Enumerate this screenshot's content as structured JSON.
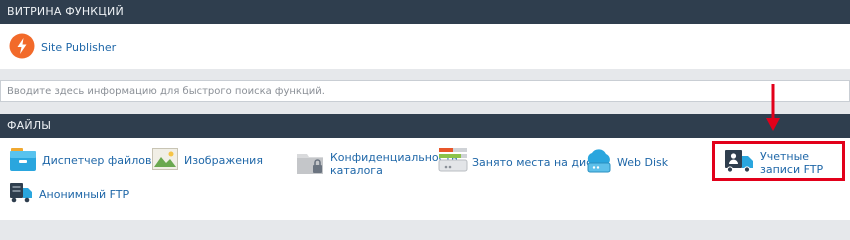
{
  "featured": {
    "title": "ВИТРИНА ФУНКЦИЙ",
    "items": [
      {
        "label": "Site Publisher",
        "icon": "lightning-bolt-icon"
      }
    ]
  },
  "search": {
    "placeholder": "Вводите здесь информацию для быстрого поиска функций."
  },
  "files": {
    "title": "ФАЙЛЫ",
    "items": [
      {
        "label": "Диспетчер файлов",
        "icon": "file-manager-icon"
      },
      {
        "label": "Изображения",
        "icon": "images-icon"
      },
      {
        "label_line1": "Конфиденциальность",
        "label_line2": "каталога",
        "icon": "folder-lock-icon"
      },
      {
        "label": "Занято места на диске",
        "icon": "disk-usage-icon"
      },
      {
        "label": "Web Disk",
        "icon": "web-disk-icon"
      },
      {
        "label": "Учетные записи FTP",
        "icon": "ftp-accounts-icon"
      },
      {
        "label": "Анонимный FTP",
        "icon": "anonymous-ftp-icon"
      }
    ]
  },
  "colors": {
    "header_bg": "#2f3e4e",
    "link": "#1f67a8",
    "highlight": "#e2001a",
    "accent_orange": "#f26a2a"
  }
}
